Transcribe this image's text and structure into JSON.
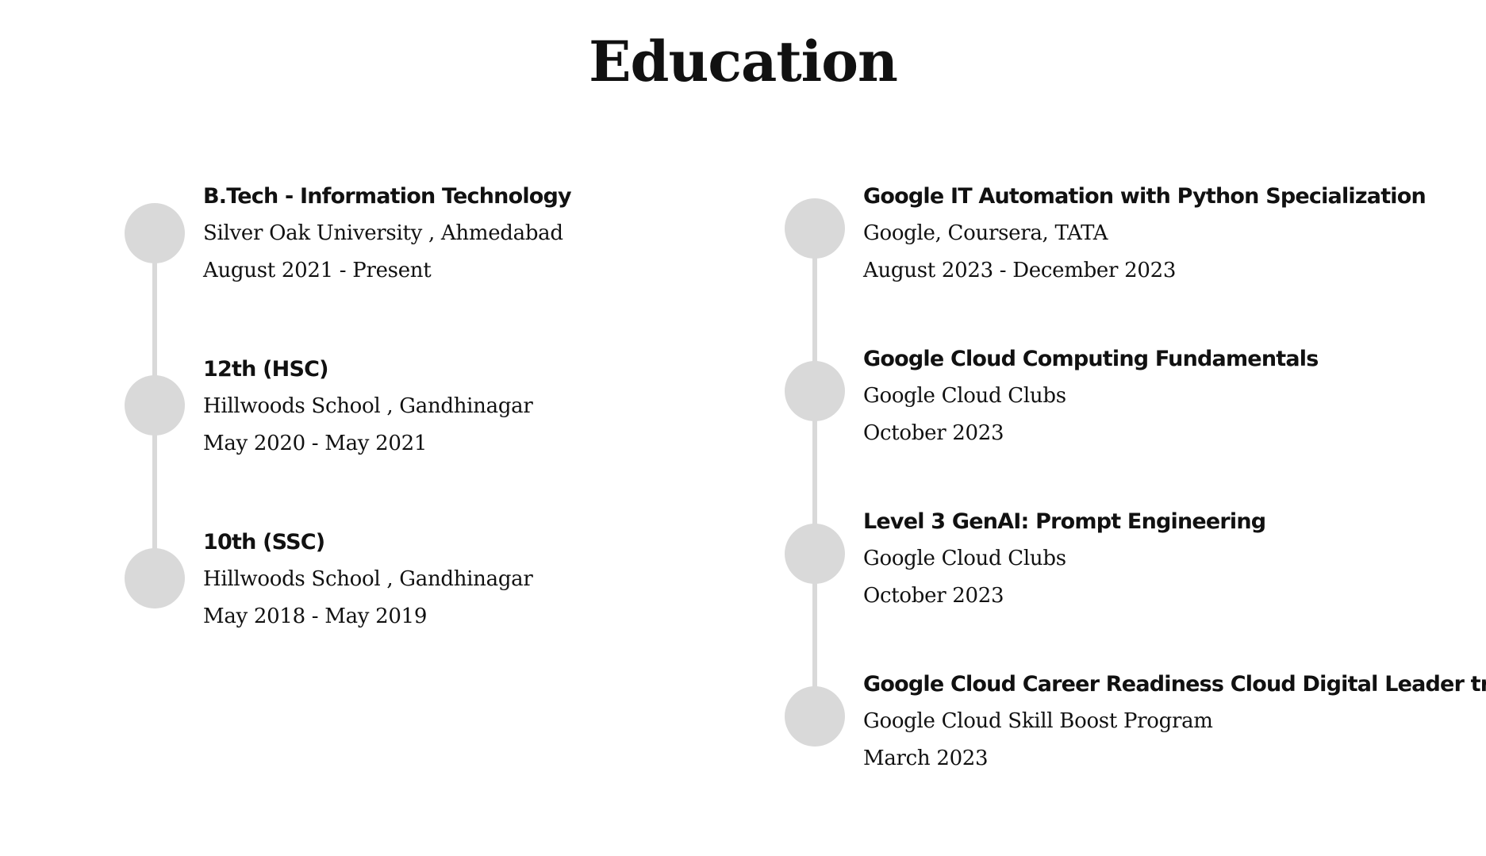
{
  "page": {
    "title": "Education"
  },
  "left_timeline": {
    "items": [
      {
        "title": "B.Tech - Information Technology",
        "institution": "Silver Oak University , Ahmedabad",
        "dates": "August 2021 - Present"
      },
      {
        "title": "12th (HSC)",
        "institution": "Hillwoods School , Gandhinagar",
        "dates": "May 2020 - May 2021"
      },
      {
        "title": "10th (SSC)",
        "institution": "Hillwoods School , Gandhinagar",
        "dates": "May 2018 - May 2019"
      }
    ]
  },
  "right_timeline": {
    "items": [
      {
        "title": "Google IT Automation with Python Specialization",
        "issuer": "Google, Coursera, TATA",
        "dates": "August 2023 - December 2023"
      },
      {
        "title": "Google Cloud Computing Fundamentals",
        "issuer": "Google Cloud Clubs",
        "dates": "October 2023"
      },
      {
        "title": "Level 3 GenAI: Prompt Engineering",
        "issuer": "Google Cloud Clubs",
        "dates": "October 2023"
      },
      {
        "title": "Google Cloud Career Readiness Cloud Digital Leader track",
        "issuer": "Google Cloud Skill Boost Program",
        "dates": "March 2023"
      }
    ]
  },
  "colors": {
    "text": "#111111",
    "timeline": "#d9d9d9",
    "background": "#ffffff"
  }
}
